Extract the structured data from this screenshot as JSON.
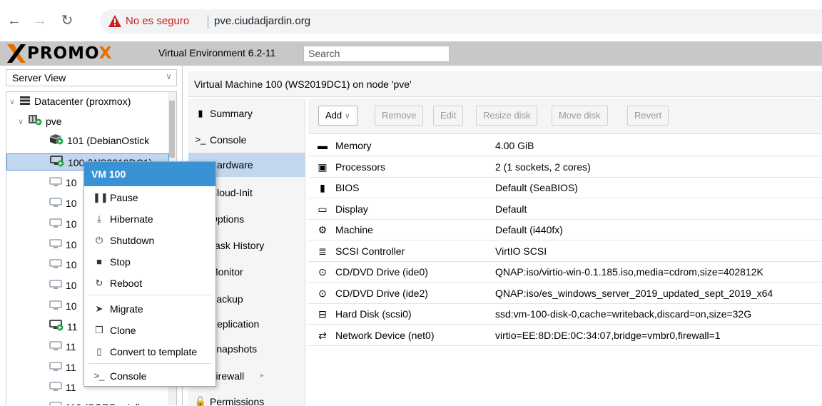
{
  "browser": {
    "back_icon": "arrow-left-icon",
    "forward_icon": "arrow-right-icon",
    "reload_icon": "reload-icon",
    "security_text": "No es seguro",
    "url": "pve.ciudadjardin.org",
    "warning_color": "#c5221f"
  },
  "header": {
    "logo_text_a": "PRO",
    "logo_text_b": "MO",
    "logo_text_c": "X",
    "version": "Virtual Environment 6.2-11",
    "search_placeholder": "Search",
    "logo_accent_color": "#e57000"
  },
  "left": {
    "view_select": "Server View",
    "tree": [
      {
        "label": "Datacenter (proxmox)",
        "icon": "datacenter-icon",
        "level": 0
      },
      {
        "label": "pve",
        "icon": "node-icon",
        "level": 1
      },
      {
        "label": "101 (DebianOstick",
        "icon": "container-icon",
        "level": 2
      },
      {
        "label": "100 (WS2019DC1)",
        "icon": "vm-running-icon",
        "level": 2,
        "selected": true
      },
      {
        "label": "10",
        "icon": "vm-icon",
        "level": 2
      },
      {
        "label": "10",
        "icon": "vm-icon",
        "level": 2
      },
      {
        "label": "10",
        "icon": "vm-icon",
        "level": 2
      },
      {
        "label": "10",
        "icon": "vm-icon",
        "level": 2
      },
      {
        "label": "10",
        "icon": "vm-icon",
        "level": 2
      },
      {
        "label": "10",
        "icon": "vm-icon",
        "level": 2
      },
      {
        "label": "10",
        "icon": "vm-icon",
        "level": 2
      },
      {
        "label": "11",
        "icon": "vm-running-icon",
        "level": 2
      },
      {
        "label": "11",
        "icon": "vm-icon",
        "level": 2
      },
      {
        "label": "11",
        "icon": "vm-icon",
        "level": 2
      },
      {
        "label": "11",
        "icon": "vm-icon",
        "level": 2
      },
      {
        "label": "119 (SORDaniel)",
        "icon": "vm-icon",
        "level": 2
      }
    ]
  },
  "main": {
    "title": "Virtual Machine 100 (WS2019DC1) on node 'pve'",
    "subnav": [
      {
        "label": "Summary",
        "icon": "book-icon"
      },
      {
        "label": "Console",
        "icon": "terminal-icon"
      },
      {
        "label": "Hardware",
        "icon": "desktop-icon",
        "active": true
      },
      {
        "label": "Cloud-Init",
        "icon": "cloud-icon"
      },
      {
        "label": "Options",
        "icon": "gear-icon"
      },
      {
        "label": "Task History",
        "icon": "list-icon"
      },
      {
        "label": "Monitor",
        "icon": "eye-icon"
      },
      {
        "label": "Backup",
        "icon": "floppy-icon"
      },
      {
        "label": "Replication",
        "icon": "retweet-icon"
      },
      {
        "label": "Snapshots",
        "icon": "history-icon"
      },
      {
        "label": "Firewall",
        "icon": "shield-icon"
      },
      {
        "label": "Permissions",
        "icon": "unlock-icon"
      }
    ],
    "toolbar": {
      "add": "Add",
      "remove": "Remove",
      "edit": "Edit",
      "resize": "Resize disk",
      "move": "Move disk",
      "revert": "Revert"
    },
    "hardware": [
      {
        "name": "Memory",
        "value": "4.00 GiB",
        "icon": "memory-icon"
      },
      {
        "name": "Processors",
        "value": "2 (1 sockets, 2 cores)",
        "icon": "cpu-icon"
      },
      {
        "name": "BIOS",
        "value": "Default (SeaBIOS)",
        "icon": "microchip-icon"
      },
      {
        "name": "Display",
        "value": "Default",
        "icon": "desktop-icon"
      },
      {
        "name": "Machine",
        "value": "Default (i440fx)",
        "icon": "cogs-icon"
      },
      {
        "name": "SCSI Controller",
        "value": "VirtIO SCSI",
        "icon": "database-icon"
      },
      {
        "name": "CD/DVD Drive (ide0)",
        "value": "QNAP:iso/virtio-win-0.1.185.iso,media=cdrom,size=402812K",
        "icon": "cdrom-icon"
      },
      {
        "name": "CD/DVD Drive (ide2)",
        "value": "QNAP:iso/es_windows_server_2019_updated_sept_2019_x64",
        "icon": "cdrom-icon"
      },
      {
        "name": "Hard Disk (scsi0)",
        "value": "ssd:vm-100-disk-0,cache=writeback,discard=on,size=32G",
        "icon": "hdd-icon"
      },
      {
        "name": "Network Device (net0)",
        "value": "virtio=EE:8D:DE:0C:34:07,bridge=vmbr0,firewall=1",
        "icon": "exchange-icon"
      }
    ]
  },
  "context_menu": {
    "title": "VM 100",
    "items": [
      {
        "label": "Pause",
        "icon": "pause-icon"
      },
      {
        "label": "Hibernate",
        "icon": "download-icon"
      },
      {
        "label": "Shutdown",
        "icon": "power-icon"
      },
      {
        "label": "Stop",
        "icon": "stop-icon"
      },
      {
        "label": "Reboot",
        "icon": "refresh-icon"
      },
      {
        "label": "Migrate",
        "icon": "send-icon"
      },
      {
        "label": "Clone",
        "icon": "clone-icon"
      },
      {
        "label": "Convert to template",
        "icon": "file-icon"
      },
      {
        "label": "Console",
        "icon": "terminal-icon"
      }
    ]
  },
  "colors": {
    "selection": "#c0d7ee",
    "menu_header": "#3892d4",
    "running_green": "#2aa84a"
  }
}
